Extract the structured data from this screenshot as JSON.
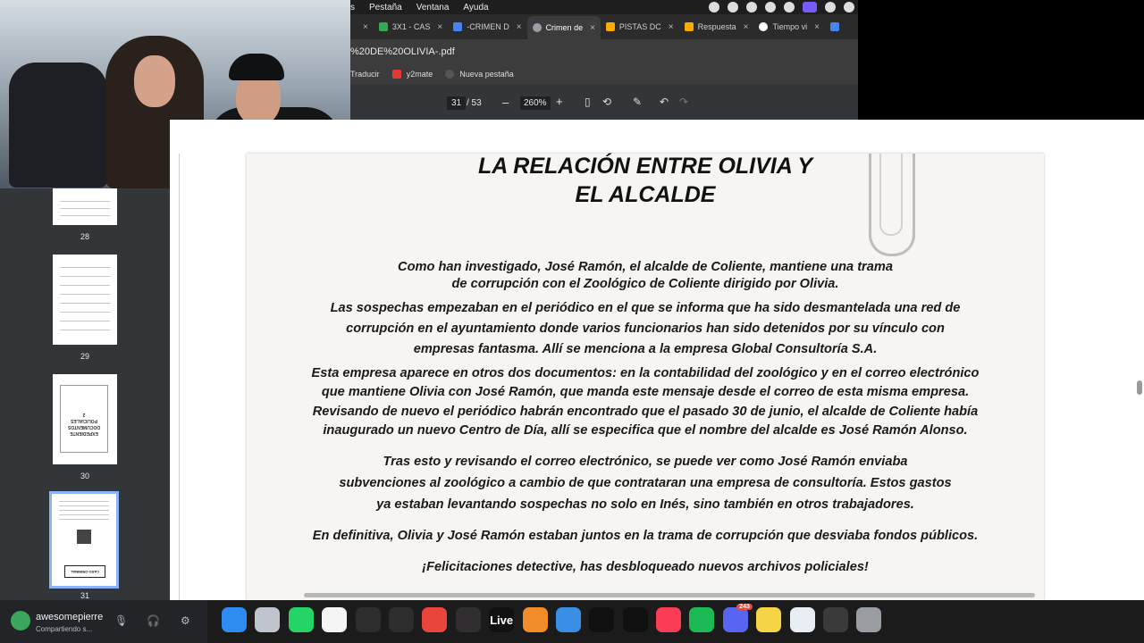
{
  "menubar": {
    "items": [
      "s",
      "Pestaña",
      "Ventana",
      "Ayuda"
    ]
  },
  "tabs": [
    {
      "label": "",
      "close": "×",
      "color": "#888888"
    },
    {
      "label": "3X1 - CAS",
      "close": "×",
      "color": "#34a853"
    },
    {
      "label": "-CRIMEN D",
      "close": "×",
      "color": "#4285f4"
    },
    {
      "label": "Crimen de",
      "close": "×",
      "color": "#9aa0a6",
      "active": true
    },
    {
      "label": "PISTAS DC",
      "close": "×",
      "color": "#f9ab00"
    },
    {
      "label": "Respuesta",
      "close": "×",
      "color": "#f9ab00"
    },
    {
      "label": "Tiempo vi",
      "close": "×",
      "color": "#ffffff"
    },
    {
      "label": "",
      "close": "",
      "color": "#4285f4"
    }
  ],
  "url": {
    "text": "%20DE%20OLIVIA-.pdf"
  },
  "bookmarks": [
    {
      "label": "Traducir",
      "color": ""
    },
    {
      "label": "y2mate",
      "color": "#e53935"
    },
    {
      "label": "Nueva pestaña",
      "color": "#555555"
    }
  ],
  "pdf_toolbar": {
    "page_current": "31",
    "page_total": "/ 53",
    "zoom_minus": "–",
    "zoom": "260%",
    "zoom_plus": "+"
  },
  "thumbnails": [
    {
      "page": "28"
    },
    {
      "page": "29"
    },
    {
      "page": "30"
    },
    {
      "page": "31",
      "selected": true
    }
  ],
  "document": {
    "title_line1": "LA RELACIÓN ENTRE OLIVIA Y",
    "title_line2": "EL ALCALDE",
    "p1_line1": "Como han investigado, José Ramón, el alcalde de Coliente, mantiene una trama",
    "p1_line2": "de corrupción con el Zoológico de Coliente dirigido por Olivia.",
    "p2_line1": "Las sospechas empezaban en el periódico en el que se informa que ha sido desmantelada una red de",
    "p2_line2": "corrupción en el ayuntamiento donde varios funcionarios han sido detenidos por su vínculo con",
    "p2_line3": "empresas fantasma. Allí se menciona a la empresa Global Consultoría S.A.",
    "p3_line1": "Esta empresa aparece en otros dos documentos: en la contabilidad del zoológico y en el correo electrónico",
    "p3_line2": "que mantiene Olivia con José Ramón, que manda este mensaje desde el correo de esta misma empresa.",
    "p3_line3": "Revisando de nuevo el periódico habrán encontrado que el pasado 30 de junio, el alcalde de Coliente había",
    "p3_line4": "inaugurado un nuevo Centro de Día, allí se especifica que el nombre del alcalde es José Ramón Alonso.",
    "p4_line1": "Tras esto y revisando el correo electrónico, se puede ver como José Ramón  enviaba",
    "p4_line2": "subvenciones al zoológico a cambio de que contrataran una empresa de consultoría. Estos gastos",
    "p4_line3": "ya estaban levantando sospechas no solo en Inés, sino también en otros trabajadores.",
    "p5": "En definitiva, Olivia y José Ramón estaban juntos en la trama de corrupción que desviaba fondos públicos.",
    "p6": "¡Felicitaciones detective, has desbloqueado nuevos archivos policiales!"
  },
  "thumb30_text": [
    "EXPEDIENTE",
    "DOCUMENTOS",
    "POLICIALES",
    "2"
  ],
  "thumb31_text": "CASO CRIMINAL",
  "discord": {
    "username": "awesomepierre",
    "status": "Compartiendo s..."
  },
  "dock": [
    {
      "name": "finder",
      "label": "",
      "color": "#2e8bf0"
    },
    {
      "name": "launchpad",
      "label": "",
      "color": "#c0c4cc"
    },
    {
      "name": "whatsapp",
      "label": "",
      "color": "#25d366"
    },
    {
      "name": "capcut",
      "label": "",
      "color": "#f5f5f5"
    },
    {
      "name": "app-circle-1",
      "label": "",
      "color": "#2d2d2d"
    },
    {
      "name": "mixer",
      "label": "",
      "color": "#2d2d2d"
    },
    {
      "name": "chrome",
      "label": "",
      "color": "#e8453c"
    },
    {
      "name": "obs",
      "label": "",
      "color": "#302e31"
    },
    {
      "name": "live",
      "label": "Live",
      "color": "#111111"
    },
    {
      "name": "fl-studio",
      "label": "",
      "color": "#f08c2a"
    },
    {
      "name": "app-blue",
      "label": "",
      "color": "#3a8ee6"
    },
    {
      "name": "tidal",
      "label": "",
      "color": "#111111"
    },
    {
      "name": "waveform",
      "label": "",
      "color": "#111111"
    },
    {
      "name": "music",
      "label": "",
      "color": "#fa3c57"
    },
    {
      "name": "spotify",
      "label": "",
      "color": "#1db954"
    },
    {
      "name": "discord",
      "label": "",
      "color": "#5865f2",
      "badge": "243"
    },
    {
      "name": "notes",
      "label": "",
      "color": "#f5d547"
    },
    {
      "name": "freeform",
      "label": "",
      "color": "#e9eef5"
    },
    {
      "name": "app-dark",
      "label": "",
      "color": "#3a3a3a"
    },
    {
      "name": "trash",
      "label": "",
      "color": "#9a9ea3"
    }
  ]
}
